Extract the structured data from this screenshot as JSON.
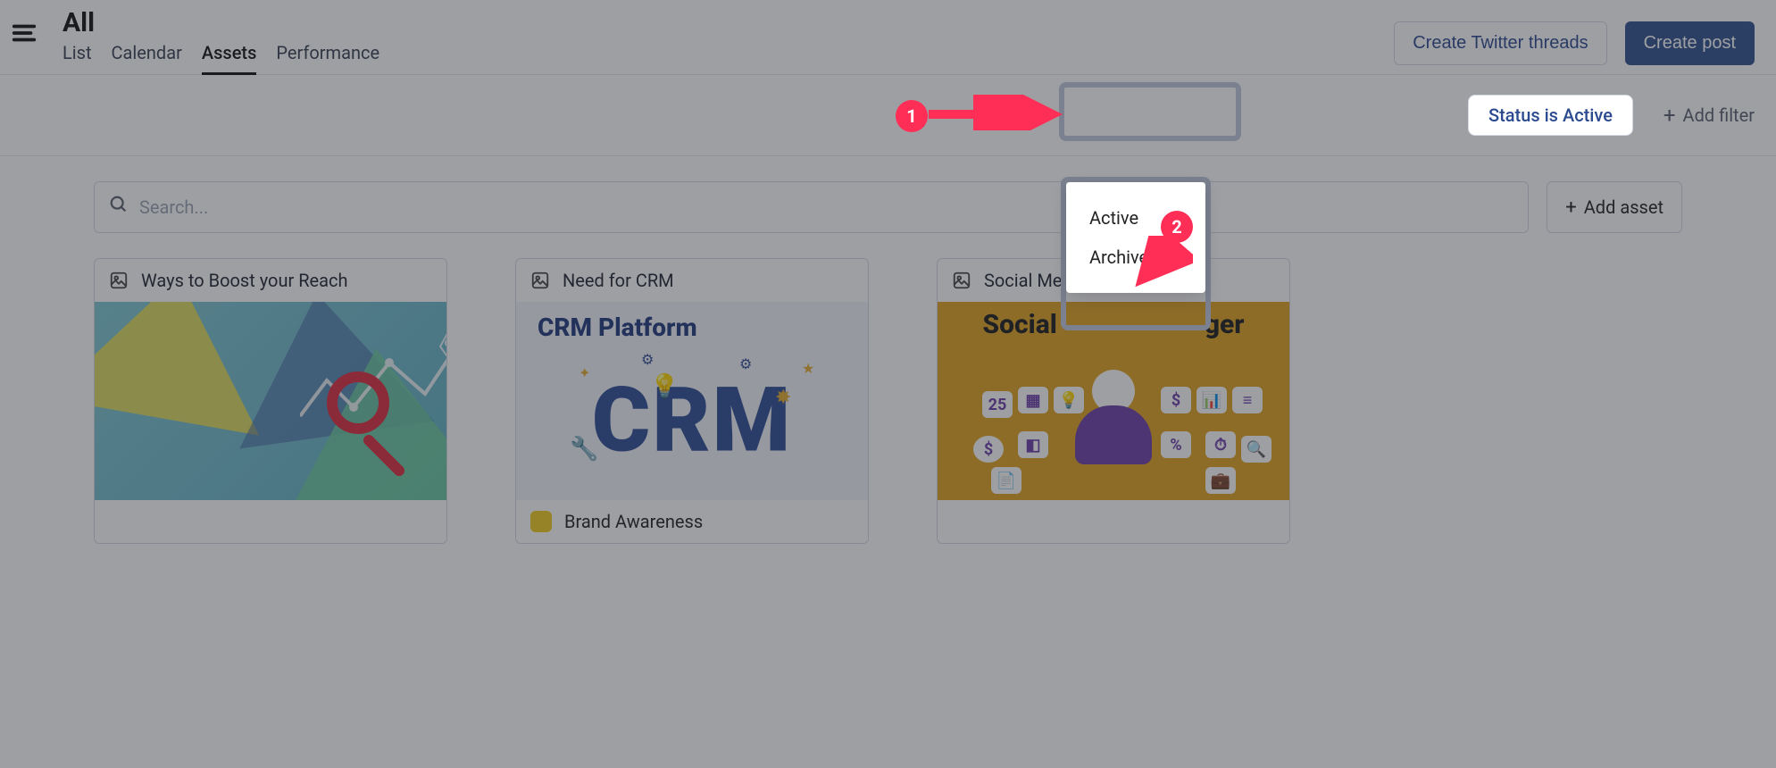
{
  "header": {
    "title": "All",
    "tabs": [
      "List",
      "Calendar",
      "Assets",
      "Performance"
    ],
    "active_tab_index": 2,
    "create_threads_label": "Create Twitter threads",
    "create_post_label": "Create post"
  },
  "filter": {
    "status_label": "Status is Active",
    "add_filter_label": "Add filter"
  },
  "search": {
    "placeholder": "Search...",
    "add_asset_label": "Add asset"
  },
  "cards": [
    {
      "title": "Ways to Boost your Reach",
      "tag": null
    },
    {
      "title": "Need for CRM",
      "tag": "Brand Awareness",
      "headline": "CRM Platform"
    },
    {
      "title": "Social Me",
      "headline_left": "Social",
      "headline_right": "ger"
    }
  ],
  "dropdown": {
    "items": [
      "Active",
      "Archive"
    ]
  },
  "callouts": {
    "one": "1",
    "two": "2"
  }
}
